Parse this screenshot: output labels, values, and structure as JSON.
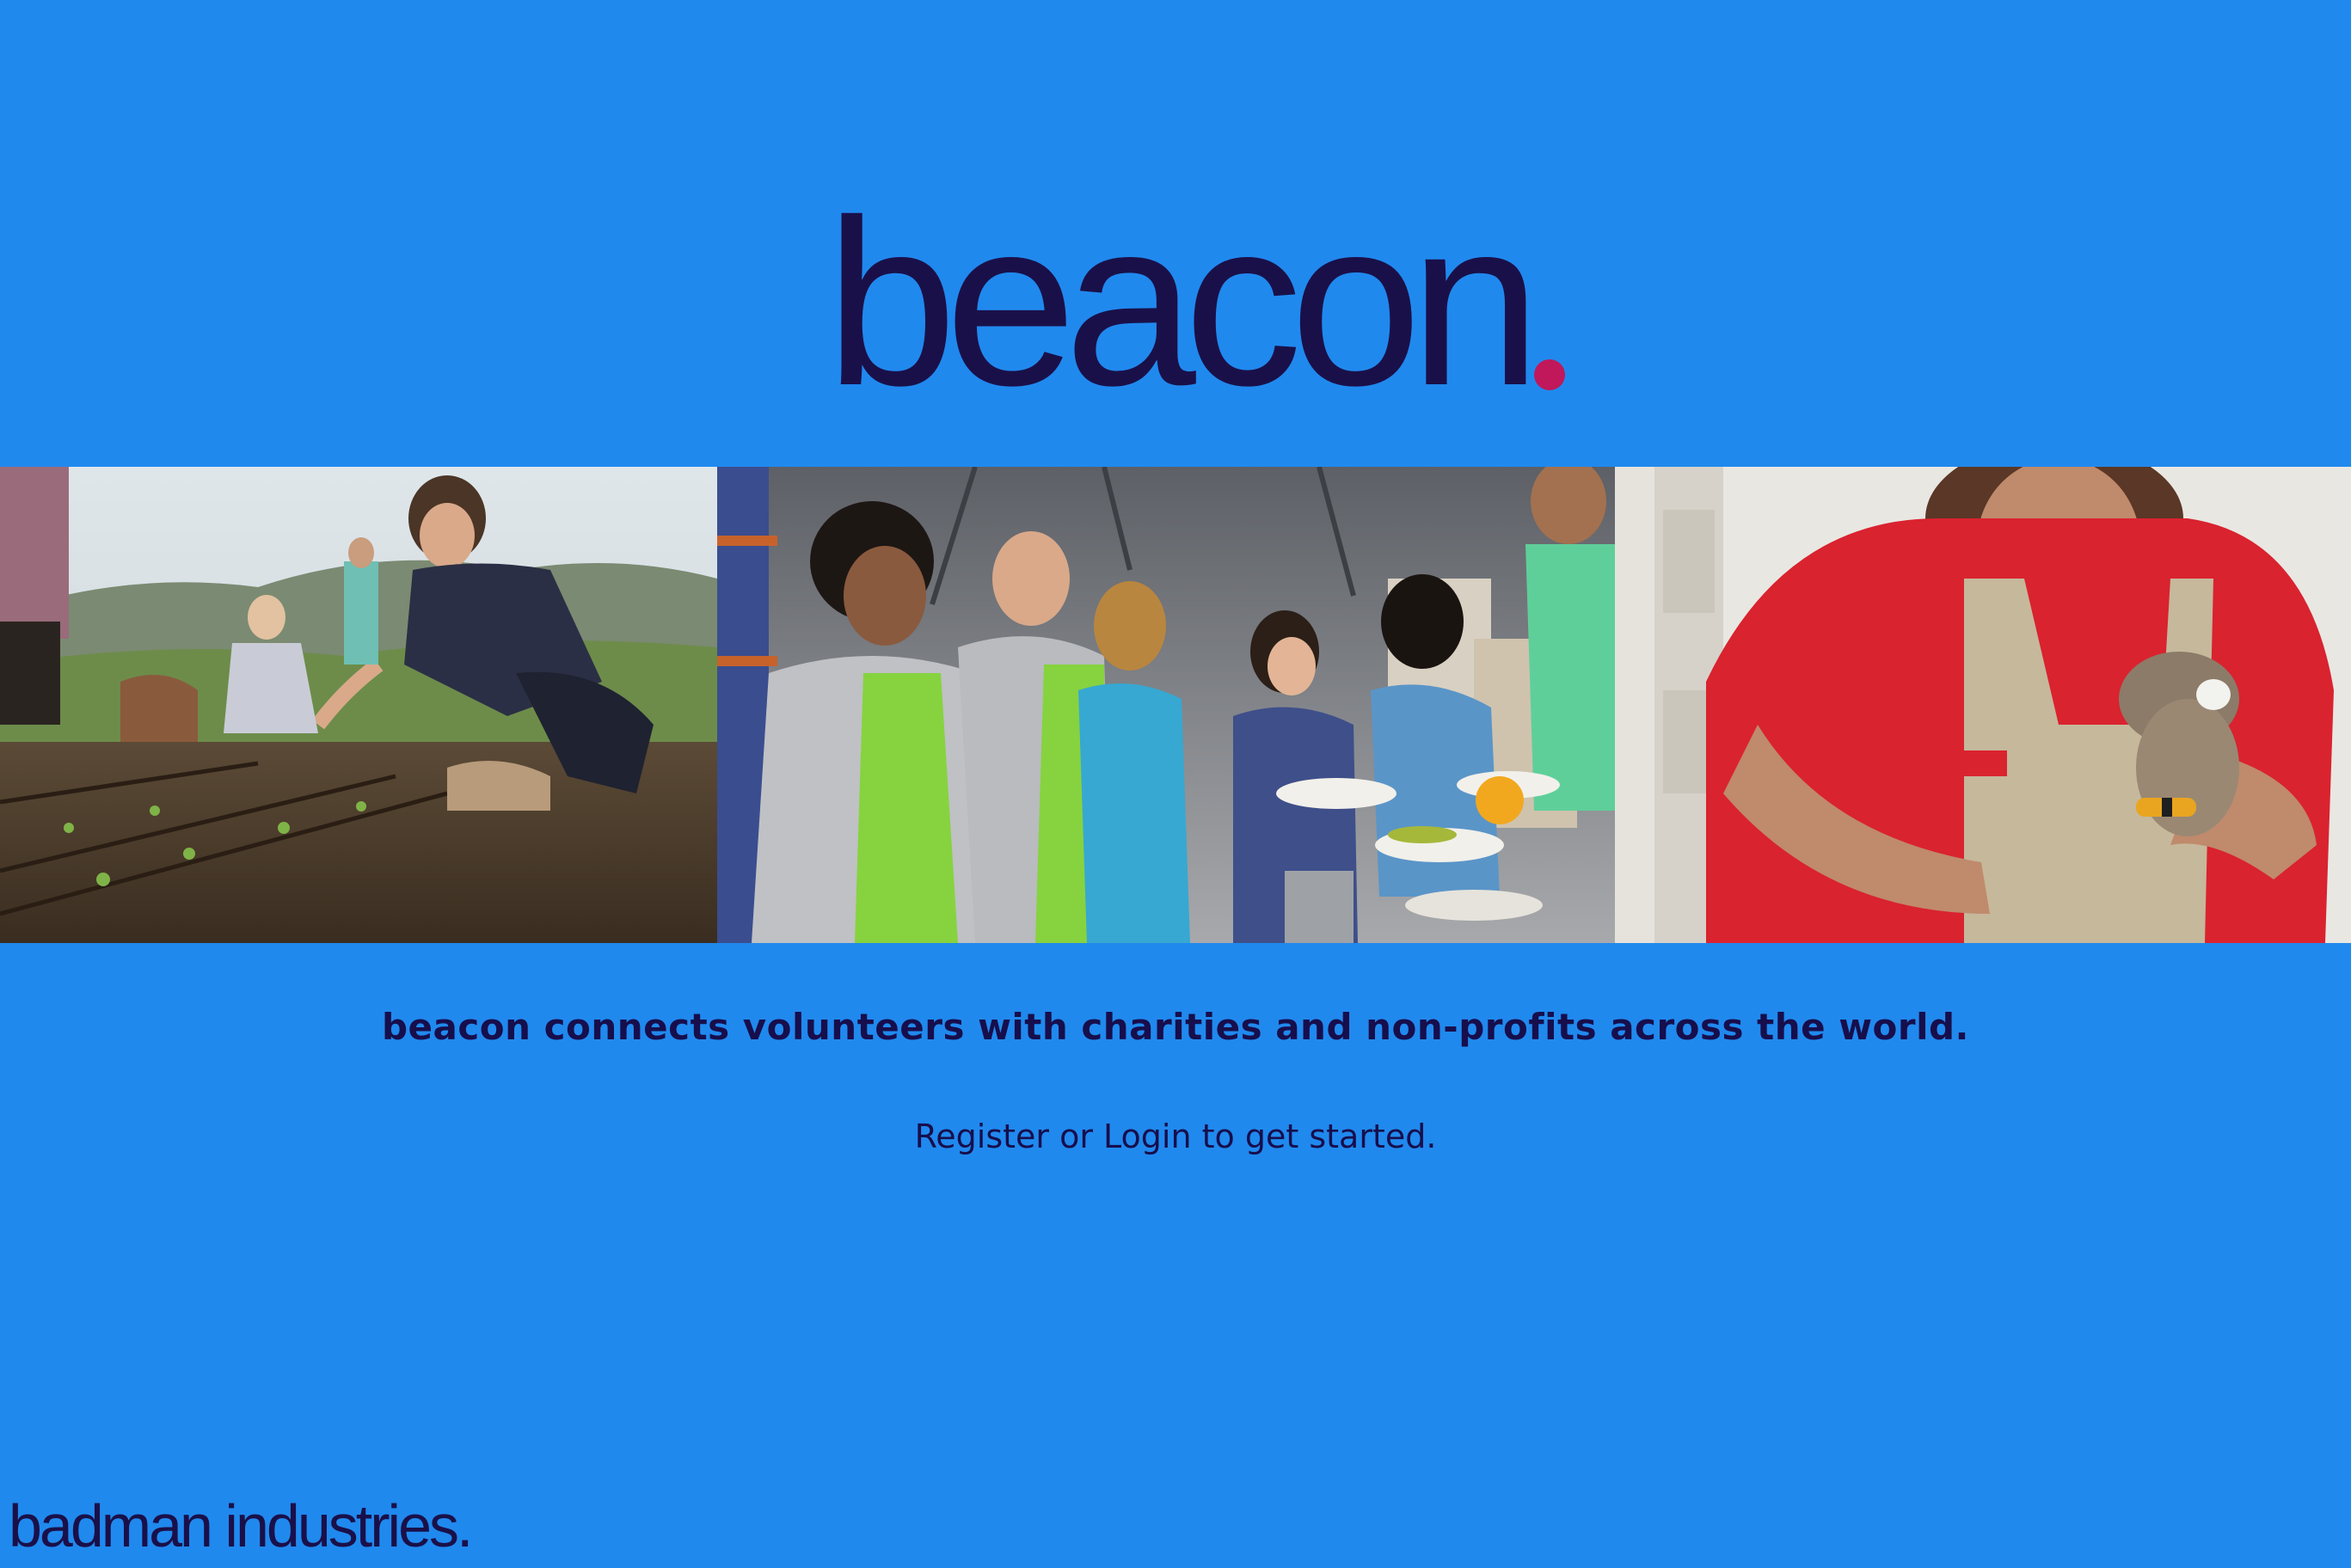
{
  "brand": {
    "logo_text": "beacon",
    "logo_dot_color": "#c0185a",
    "logo_text_color": "#1a1049"
  },
  "theme": {
    "background": "#2089ee",
    "text_color": "#170e4c"
  },
  "photos": [
    {
      "name": "gardening-volunteers-photo"
    },
    {
      "name": "food-serving-volunteers-photo"
    },
    {
      "name": "animal-shelter-volunteer-photo"
    }
  ],
  "main": {
    "tagline": "beacon connects volunteers with charities and non-profits across the world.",
    "cta": {
      "register_label": "Register",
      "or_text": " or ",
      "login_label": "Login",
      "suffix_text": " to get started."
    }
  },
  "footer": {
    "brand_text": "badman industries."
  }
}
